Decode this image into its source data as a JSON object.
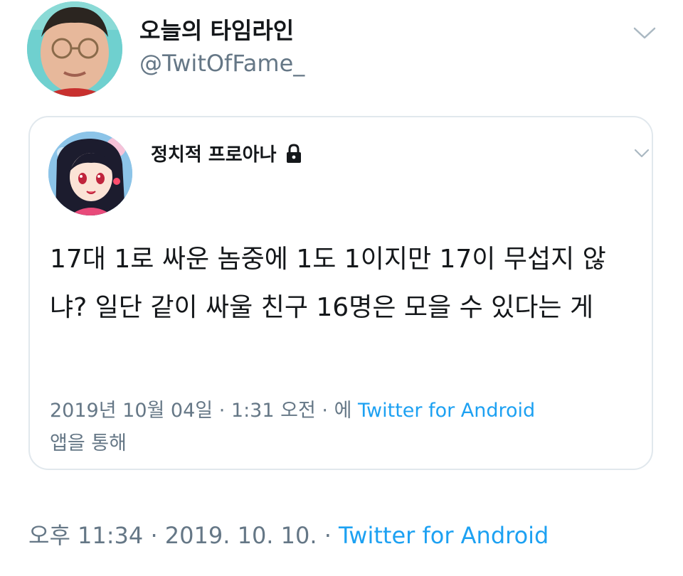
{
  "tweet": {
    "author_name": "오늘의 타임라인",
    "author_handle": "@TwitOfFame_",
    "menu_icon": "chevron-down-icon",
    "time": "오후 11:34",
    "separator": "·",
    "date": "2019. 10. 10.",
    "source": "Twitter for Android"
  },
  "quoted_tweet": {
    "author_name": "정치적 프로아나",
    "protected_icon": "lock-icon",
    "menu_icon": "chevron-down-icon",
    "body": "17대 1로 싸운 놈중에 1도 1이지만 17이 무섭지 않냐? 일단 같이 싸울 친구 16명은 모을 수 있다는 게",
    "date": "2019년 10월 04일",
    "separator": "·",
    "time": "1:31 오전",
    "via_prefix": "· 에",
    "source": "Twitter for Android",
    "via_suffix": "앱을 통해"
  },
  "colors": {
    "text": "#14171a",
    "secondary": "#657786",
    "link": "#1da1f2",
    "border": "#e1e8ed"
  }
}
